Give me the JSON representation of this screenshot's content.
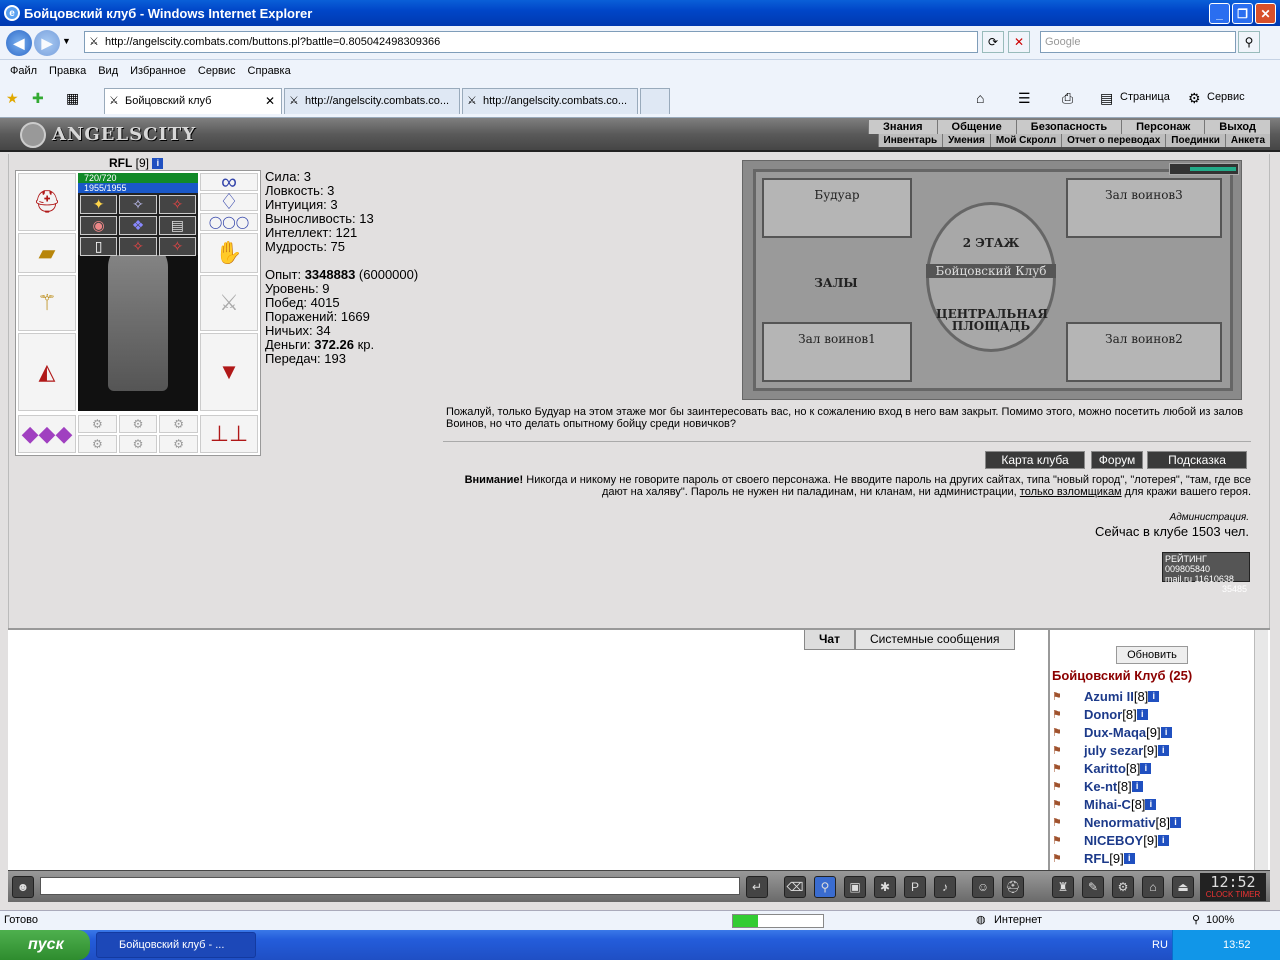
{
  "window": {
    "title": "Бойцовский клуб - Windows Internet Explorer"
  },
  "browser": {
    "url": "http://angelscity.combats.com/buttons.pl?battle=0.805042498309366",
    "search_placeholder": "Google",
    "menu": [
      "Файл",
      "Правка",
      "Вид",
      "Избранное",
      "Сервис",
      "Справка"
    ],
    "tabs": [
      {
        "label": "Бойцовский клуб"
      },
      {
        "label": "http://angelscity.combats.co..."
      },
      {
        "label": "http://angelscity.combats.co..."
      }
    ],
    "toolbar": {
      "page": "Страница",
      "tools": "Сервис"
    }
  },
  "game": {
    "logo": "ANGELSCITY",
    "topnav": [
      "Знания",
      "Общение",
      "Безопасность",
      "Персонаж",
      "Выход"
    ],
    "subnav": [
      "Инвентарь",
      "Умения",
      "Мой Скролл",
      "Отчет о переводах",
      "Поединки",
      "Анкета"
    ],
    "character": {
      "name": "RFL",
      "level": "[9]",
      "hp": "720/720",
      "mana": "1955/1955"
    },
    "stats": {
      "strength": "Сила: 3",
      "agility": "Ловкость: 3",
      "intuition": "Интуиция: 3",
      "endurance": "Выносливость: 13",
      "intellect": "Интеллект: 121",
      "wisdom": "Мудрость: 75",
      "exp_label": "Опыт: ",
      "exp_value": "3348883",
      "exp_next": " (6000000)",
      "level": "Уровень: 9",
      "wins": "Побед: 4015",
      "losses": "Поражений: 1669",
      "draws": "Ничьих: 34",
      "money_label": "Деньги: ",
      "money_value": "372.26",
      "money_unit": " кр.",
      "transfers": "Передач: 193"
    },
    "map": {
      "boudoir": "Будуар",
      "hall3": "Зал воинов3",
      "floor": "2 ЭТАЖ",
      "club": "Бойцовский Клуб",
      "halls": "ЗАЛЫ",
      "central": "ЦЕНТРАЛЬНАЯ ПЛОЩАДЬ",
      "hall1": "Зал воинов1",
      "hall2": "Зал воинов2"
    },
    "description": "Пожалуй, только Будуар на этом этаже мог бы заинтересовать вас, но к сожалению вход в него вам закрыт. Помимо этого, можно посетить любой из залов Воинов, но что делать опытному бойцу среди новичков?",
    "buttons": {
      "map": "Карта клуба",
      "forum": "Форум",
      "hint": "Подсказка"
    },
    "warning": {
      "bold": "Внимание!",
      "text1": " Никогда и никому не говорите пароль от своего персонажа. Не вводите пароль на других сайтах, типа \"новый город\", \"лотерея\", \"там, где все дают на халяву\". Пароль не нужен ни паладинам, ни кланам, ни администрации, ",
      "link": "только взломщикам",
      "text2": " для кражи вашего героя.",
      "admin": "Администрация."
    },
    "online": "Сейчас в клубе 1503 чел.",
    "counter": {
      "line1": "РЕЙТИНГ 009805840",
      "line2": "mail.ru 11610638",
      "line3": "35485"
    }
  },
  "chat": {
    "tabs": [
      "Чат",
      "Системные сообщения"
    ],
    "refresh": "Обновить",
    "room": "Бойцовский Клуб (25)",
    "users": [
      {
        "name": "Azumi II",
        "level": "[8]"
      },
      {
        "name": "Donor",
        "level": "[8]"
      },
      {
        "name": "Dux-Maqa",
        "level": "[9]"
      },
      {
        "name": "july sezar",
        "level": "[9]"
      },
      {
        "name": "Karitto",
        "level": "[8]"
      },
      {
        "name": "Ke-nt",
        "level": "[8]"
      },
      {
        "name": "Mihai-C",
        "level": "[8]"
      },
      {
        "name": "Nenormativ",
        "level": "[8]"
      },
      {
        "name": "NICEBOY",
        "level": "[9]"
      },
      {
        "name": "RFL",
        "level": "[9]"
      }
    ],
    "clock": "12:52",
    "clock_sub": "CLOCK TIMER"
  },
  "status": {
    "ready": "Готово",
    "zone": "Интернет",
    "zoom": "100%"
  },
  "taskbar": {
    "start": "пуск",
    "task": "Бойцовский клуб - ...",
    "lang": "RU",
    "time": "13:52"
  }
}
